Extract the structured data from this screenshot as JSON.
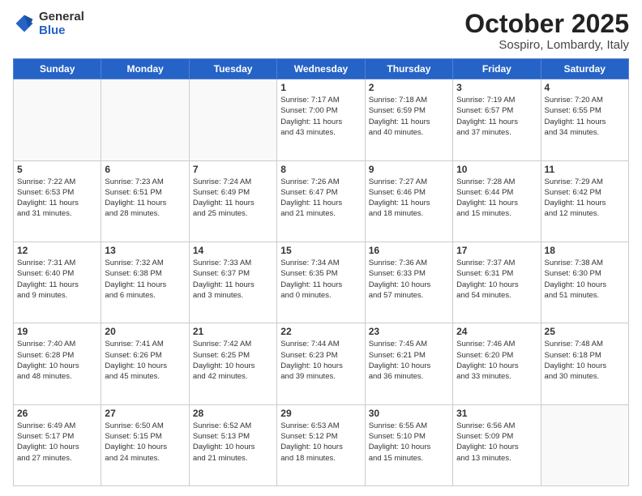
{
  "header": {
    "logo": {
      "general": "General",
      "blue": "Blue"
    },
    "title": "October 2025",
    "subtitle": "Sospiro, Lombardy, Italy"
  },
  "days_of_week": [
    "Sunday",
    "Monday",
    "Tuesday",
    "Wednesday",
    "Thursday",
    "Friday",
    "Saturday"
  ],
  "weeks": [
    [
      {
        "day": "",
        "info": ""
      },
      {
        "day": "",
        "info": ""
      },
      {
        "day": "",
        "info": ""
      },
      {
        "day": "1",
        "info": "Sunrise: 7:17 AM\nSunset: 7:00 PM\nDaylight: 11 hours\nand 43 minutes."
      },
      {
        "day": "2",
        "info": "Sunrise: 7:18 AM\nSunset: 6:59 PM\nDaylight: 11 hours\nand 40 minutes."
      },
      {
        "day": "3",
        "info": "Sunrise: 7:19 AM\nSunset: 6:57 PM\nDaylight: 11 hours\nand 37 minutes."
      },
      {
        "day": "4",
        "info": "Sunrise: 7:20 AM\nSunset: 6:55 PM\nDaylight: 11 hours\nand 34 minutes."
      }
    ],
    [
      {
        "day": "5",
        "info": "Sunrise: 7:22 AM\nSunset: 6:53 PM\nDaylight: 11 hours\nand 31 minutes."
      },
      {
        "day": "6",
        "info": "Sunrise: 7:23 AM\nSunset: 6:51 PM\nDaylight: 11 hours\nand 28 minutes."
      },
      {
        "day": "7",
        "info": "Sunrise: 7:24 AM\nSunset: 6:49 PM\nDaylight: 11 hours\nand 25 minutes."
      },
      {
        "day": "8",
        "info": "Sunrise: 7:26 AM\nSunset: 6:47 PM\nDaylight: 11 hours\nand 21 minutes."
      },
      {
        "day": "9",
        "info": "Sunrise: 7:27 AM\nSunset: 6:46 PM\nDaylight: 11 hours\nand 18 minutes."
      },
      {
        "day": "10",
        "info": "Sunrise: 7:28 AM\nSunset: 6:44 PM\nDaylight: 11 hours\nand 15 minutes."
      },
      {
        "day": "11",
        "info": "Sunrise: 7:29 AM\nSunset: 6:42 PM\nDaylight: 11 hours\nand 12 minutes."
      }
    ],
    [
      {
        "day": "12",
        "info": "Sunrise: 7:31 AM\nSunset: 6:40 PM\nDaylight: 11 hours\nand 9 minutes."
      },
      {
        "day": "13",
        "info": "Sunrise: 7:32 AM\nSunset: 6:38 PM\nDaylight: 11 hours\nand 6 minutes."
      },
      {
        "day": "14",
        "info": "Sunrise: 7:33 AM\nSunset: 6:37 PM\nDaylight: 11 hours\nand 3 minutes."
      },
      {
        "day": "15",
        "info": "Sunrise: 7:34 AM\nSunset: 6:35 PM\nDaylight: 11 hours\nand 0 minutes."
      },
      {
        "day": "16",
        "info": "Sunrise: 7:36 AM\nSunset: 6:33 PM\nDaylight: 10 hours\nand 57 minutes."
      },
      {
        "day": "17",
        "info": "Sunrise: 7:37 AM\nSunset: 6:31 PM\nDaylight: 10 hours\nand 54 minutes."
      },
      {
        "day": "18",
        "info": "Sunrise: 7:38 AM\nSunset: 6:30 PM\nDaylight: 10 hours\nand 51 minutes."
      }
    ],
    [
      {
        "day": "19",
        "info": "Sunrise: 7:40 AM\nSunset: 6:28 PM\nDaylight: 10 hours\nand 48 minutes."
      },
      {
        "day": "20",
        "info": "Sunrise: 7:41 AM\nSunset: 6:26 PM\nDaylight: 10 hours\nand 45 minutes."
      },
      {
        "day": "21",
        "info": "Sunrise: 7:42 AM\nSunset: 6:25 PM\nDaylight: 10 hours\nand 42 minutes."
      },
      {
        "day": "22",
        "info": "Sunrise: 7:44 AM\nSunset: 6:23 PM\nDaylight: 10 hours\nand 39 minutes."
      },
      {
        "day": "23",
        "info": "Sunrise: 7:45 AM\nSunset: 6:21 PM\nDaylight: 10 hours\nand 36 minutes."
      },
      {
        "day": "24",
        "info": "Sunrise: 7:46 AM\nSunset: 6:20 PM\nDaylight: 10 hours\nand 33 minutes."
      },
      {
        "day": "25",
        "info": "Sunrise: 7:48 AM\nSunset: 6:18 PM\nDaylight: 10 hours\nand 30 minutes."
      }
    ],
    [
      {
        "day": "26",
        "info": "Sunrise: 6:49 AM\nSunset: 5:17 PM\nDaylight: 10 hours\nand 27 minutes."
      },
      {
        "day": "27",
        "info": "Sunrise: 6:50 AM\nSunset: 5:15 PM\nDaylight: 10 hours\nand 24 minutes."
      },
      {
        "day": "28",
        "info": "Sunrise: 6:52 AM\nSunset: 5:13 PM\nDaylight: 10 hours\nand 21 minutes."
      },
      {
        "day": "29",
        "info": "Sunrise: 6:53 AM\nSunset: 5:12 PM\nDaylight: 10 hours\nand 18 minutes."
      },
      {
        "day": "30",
        "info": "Sunrise: 6:55 AM\nSunset: 5:10 PM\nDaylight: 10 hours\nand 15 minutes."
      },
      {
        "day": "31",
        "info": "Sunrise: 6:56 AM\nSunset: 5:09 PM\nDaylight: 10 hours\nand 13 minutes."
      },
      {
        "day": "",
        "info": ""
      }
    ]
  ]
}
